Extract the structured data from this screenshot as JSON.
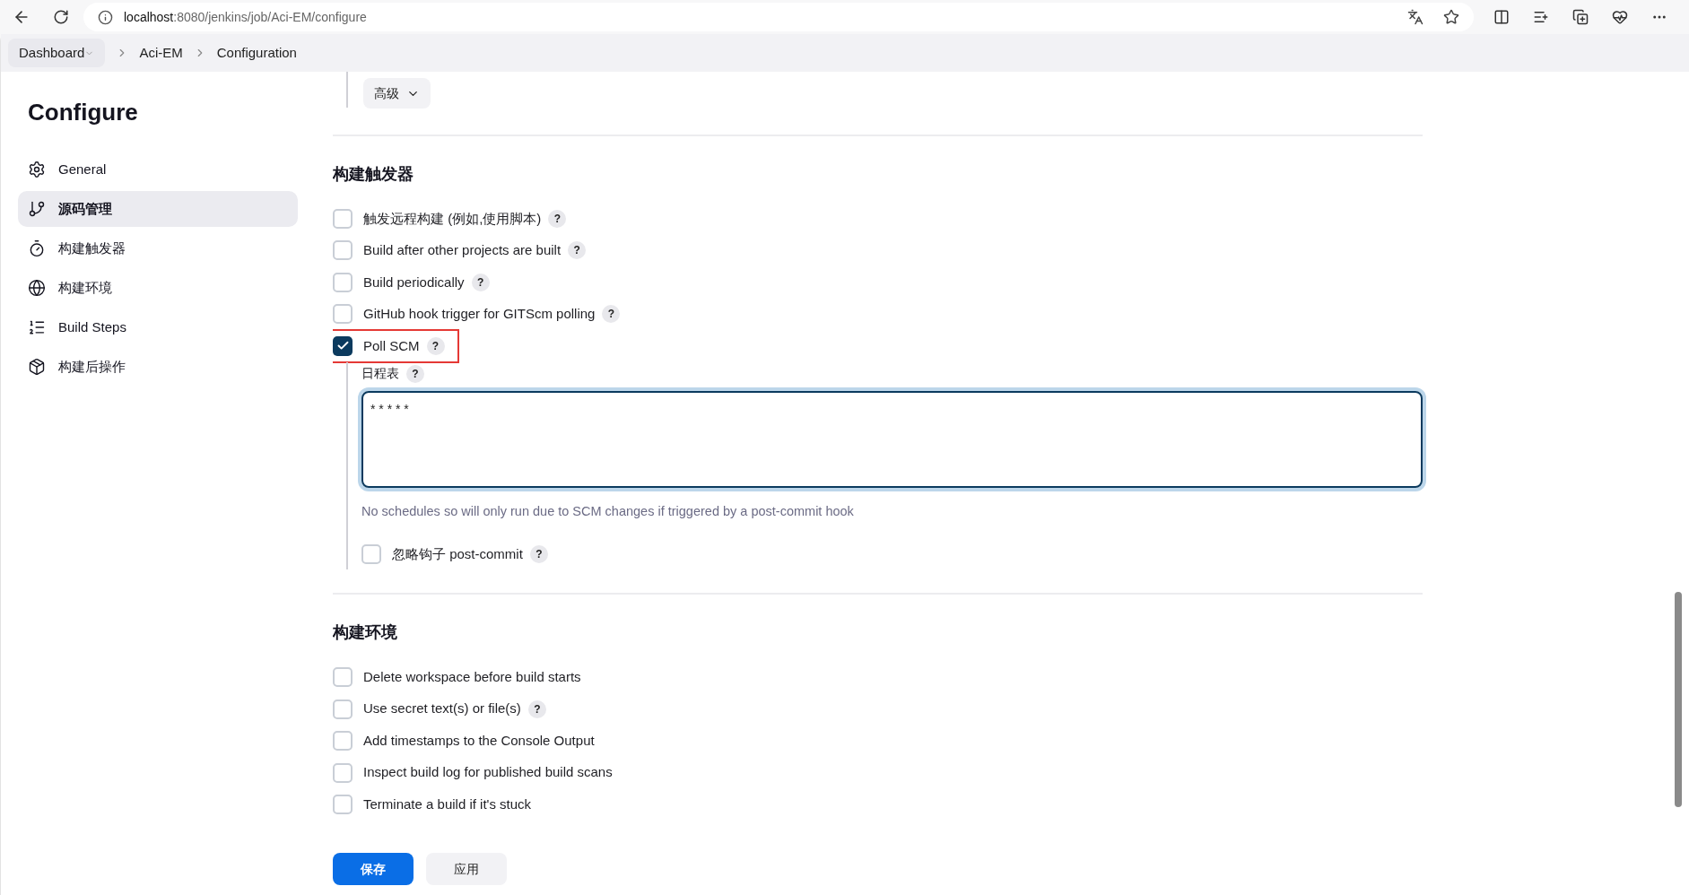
{
  "browser": {
    "url": {
      "host": "localhost",
      "path": ":8080/jenkins/job/Aci-EM/configure"
    }
  },
  "breadcrumbs": [
    {
      "label": "Dashboard",
      "menu": true
    },
    {
      "label": "Aci-EM",
      "menu": false
    },
    {
      "label": "Configuration",
      "menu": false
    }
  ],
  "sidebar": {
    "title": "Configure",
    "items": [
      {
        "label": "General",
        "selected": false
      },
      {
        "label": "源码管理",
        "selected": true
      },
      {
        "label": "构建触发器",
        "selected": false
      },
      {
        "label": "构建环境",
        "selected": false
      },
      {
        "label": "Build Steps",
        "selected": false
      },
      {
        "label": "构建后操作",
        "selected": false
      }
    ]
  },
  "advanced_button": {
    "label": "高级"
  },
  "triggers": {
    "title": "构建触发器",
    "items": [
      {
        "label": "触发远程构建 (例如,使用脚本)",
        "checked": false,
        "help": "?",
        "highlighted": false
      },
      {
        "label": "Build after other projects are built",
        "checked": false,
        "help": "?",
        "highlighted": false
      },
      {
        "label": "Build periodically",
        "checked": false,
        "help": "?",
        "highlighted": false
      },
      {
        "label": "GitHub hook trigger for GITScm polling",
        "checked": false,
        "help": "?",
        "highlighted": false
      },
      {
        "label": "Poll SCM",
        "checked": true,
        "help": "?",
        "highlighted": true
      }
    ],
    "schedule": {
      "label": "日程表",
      "help": "?",
      "value": "* * * * *",
      "hint": "No schedules so will only run due to SCM changes if triggered by a post-commit hook"
    },
    "ignore_hook": {
      "label": "忽略钩子 post-commit",
      "checked": false,
      "help": "?"
    }
  },
  "environment": {
    "title": "构建环境",
    "items": [
      {
        "label": "Delete workspace before build starts",
        "checked": false
      },
      {
        "label": "Use secret text(s) or file(s)",
        "checked": false,
        "help": "?"
      },
      {
        "label": "Add timestamps to the Console Output",
        "checked": false
      },
      {
        "label": "Inspect build log for published build scans",
        "checked": false
      },
      {
        "label": "Terminate a build if it's stuck",
        "checked": false
      }
    ]
  },
  "footer": {
    "save": "保存",
    "apply": "应用"
  }
}
